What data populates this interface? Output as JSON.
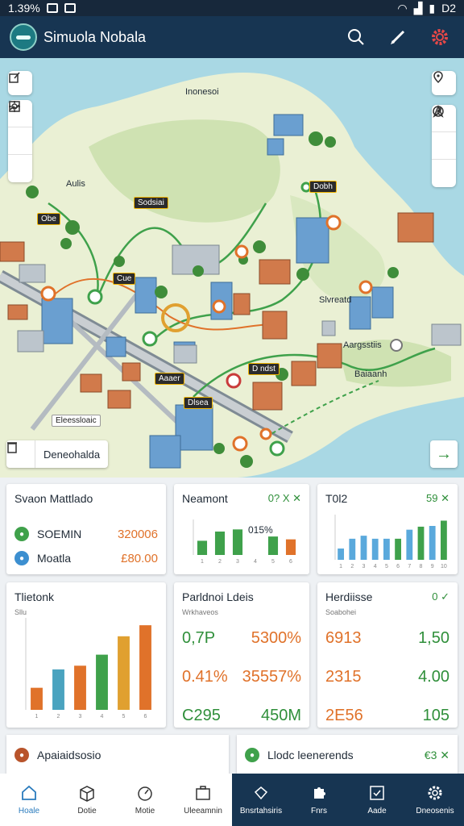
{
  "status_bar": {
    "time": "1.39%",
    "right_text": "D2"
  },
  "app": {
    "title": "Simuola Nobala"
  },
  "map": {
    "labels": {
      "top_center": "Inonesoi",
      "left_mid": "Aulis",
      "right_a": "Slvreatd",
      "right_b": "Aargsstiis",
      "right_c": "Baiaanh"
    },
    "tags": {
      "tag_a": "Sodsiai",
      "tag_b": "Dobh",
      "tag_c": "Obe",
      "tag_d": "Cue",
      "tag_e": "Aaaer",
      "tag_f": "Dlsea",
      "tag_g": "D ndst",
      "tag_h": "Eleessloaic"
    },
    "legend_chip_label": "Deneohalda"
  },
  "cards": {
    "summary": {
      "title": "Svaon Mattlado",
      "rows": [
        {
          "label": "SOEMIN",
          "value": "320006"
        },
        {
          "label": "Moatla",
          "value": "£80.00"
        }
      ]
    },
    "nearest": {
      "title": "Neamont",
      "flag": "0? X ✕",
      "annotation": "015%"
    },
    "total": {
      "title": "T0l2",
      "flag": "59 ✕"
    },
    "throughput": {
      "title": "Tlietonk",
      "sub": "Sllu"
    },
    "performance": {
      "title": "Parldnoi Ldeis",
      "sub": "Wrkhaveos",
      "metrics": [
        "0,7P",
        "5300%",
        "0.41%",
        "35557%",
        "C295",
        "450M"
      ]
    },
    "incidents": {
      "title": "Herdiisse",
      "flag": "0 ✓",
      "sub": "Soabohei",
      "metrics": [
        "6913",
        "1,50",
        "2315",
        "4.00",
        "2E56",
        "105"
      ]
    },
    "alerts_left": {
      "title": "Apaiaidsosio"
    },
    "alerts_right": {
      "title": "Llodc leenerends",
      "flag": "€3 ✕"
    }
  },
  "chart_data": [
    {
      "type": "bar",
      "title": "Neamont",
      "categories": [
        "1",
        "2",
        "3",
        "4",
        "5",
        "6"
      ],
      "values": [
        20,
        33,
        36,
        0,
        26,
        22
      ],
      "ylim": [
        0,
        50
      ]
    },
    {
      "type": "bar",
      "title": "T0l2",
      "categories": [
        "1",
        "2",
        "3",
        "4",
        "5",
        "6",
        "7",
        "8",
        "9",
        "10"
      ],
      "values": [
        15,
        28,
        32,
        28,
        28,
        28,
        40,
        44,
        45,
        52
      ],
      "ylim": [
        0,
        60
      ]
    },
    {
      "type": "bar",
      "title": "Tlietonk",
      "categories": [
        "1",
        "2",
        "3",
        "4",
        "5",
        "6"
      ],
      "values": [
        12,
        22,
        24,
        30,
        40,
        46
      ],
      "ylim": [
        0,
        50
      ]
    }
  ],
  "nav": {
    "items": [
      {
        "label": "Hoale",
        "icon": "home-icon"
      },
      {
        "label": "Dotie",
        "icon": "box-icon"
      },
      {
        "label": "Motie",
        "icon": "speed-icon"
      },
      {
        "label": "Uleeamnin",
        "icon": "briefcase-icon"
      },
      {
        "label": "Bnsrtahsiris",
        "icon": "shield-icon"
      },
      {
        "label": "Fnrs",
        "icon": "puzzle-icon"
      },
      {
        "label": "Aade",
        "icon": "checkbox-icon"
      },
      {
        "label": "Dneosenis",
        "icon": "gear-icon"
      }
    ]
  },
  "colors": {
    "green": "#2f8f3a",
    "orange": "#e0722a",
    "blue": "#5aa9dc",
    "navy": "#173552"
  }
}
